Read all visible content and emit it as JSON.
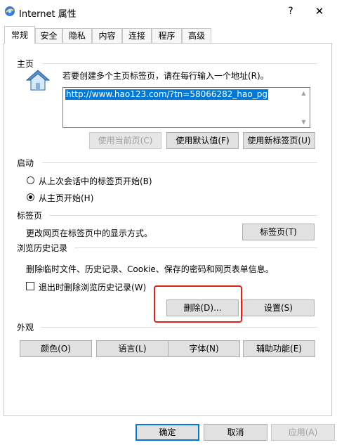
{
  "window": {
    "title": "Internet 属性",
    "help": "?",
    "close": "✕"
  },
  "tabs": [
    {
      "label": "常规"
    },
    {
      "label": "安全"
    },
    {
      "label": "隐私"
    },
    {
      "label": "内容"
    },
    {
      "label": "连接"
    },
    {
      "label": "程序"
    },
    {
      "label": "高级"
    }
  ],
  "homepage": {
    "group": "主页",
    "description": "若要创建多个主页标签页，请在每行输入一个地址(R)。",
    "url": "http://www.hao123.com/?tn=58066282_hao_pg",
    "use_current": "使用当前页(C)",
    "use_default": "使用默认值(F)",
    "use_new_tab": "使用新标签页(U)"
  },
  "startup": {
    "group": "启动",
    "option_last_session": "从上次会话中的标签页开始(B)",
    "option_homepage": "从主页开始(H)",
    "selected": "option_homepage"
  },
  "tabs_section": {
    "group": "标签页",
    "description": "更改网页在标签页中的显示方式。",
    "button": "标签页(T)"
  },
  "history": {
    "group": "浏览历史记录",
    "description": "删除临时文件、历史记录、Cookie、保存的密码和网页表单信息。",
    "delete_on_exit": "退出时删除浏览历史记录(W)",
    "delete_on_exit_checked": false,
    "delete": "删除(D)...",
    "settings": "设置(S)"
  },
  "appearance": {
    "group": "外观",
    "colors": "颜色(O)",
    "languages": "语言(L)",
    "fonts": "字体(N)",
    "accessibility": "辅助功能(E)"
  },
  "footer": {
    "ok": "确定",
    "cancel": "取消",
    "apply": "应用(A)"
  },
  "colors": {
    "accent": "#0078d7",
    "highlight_box": "#d9241c"
  }
}
